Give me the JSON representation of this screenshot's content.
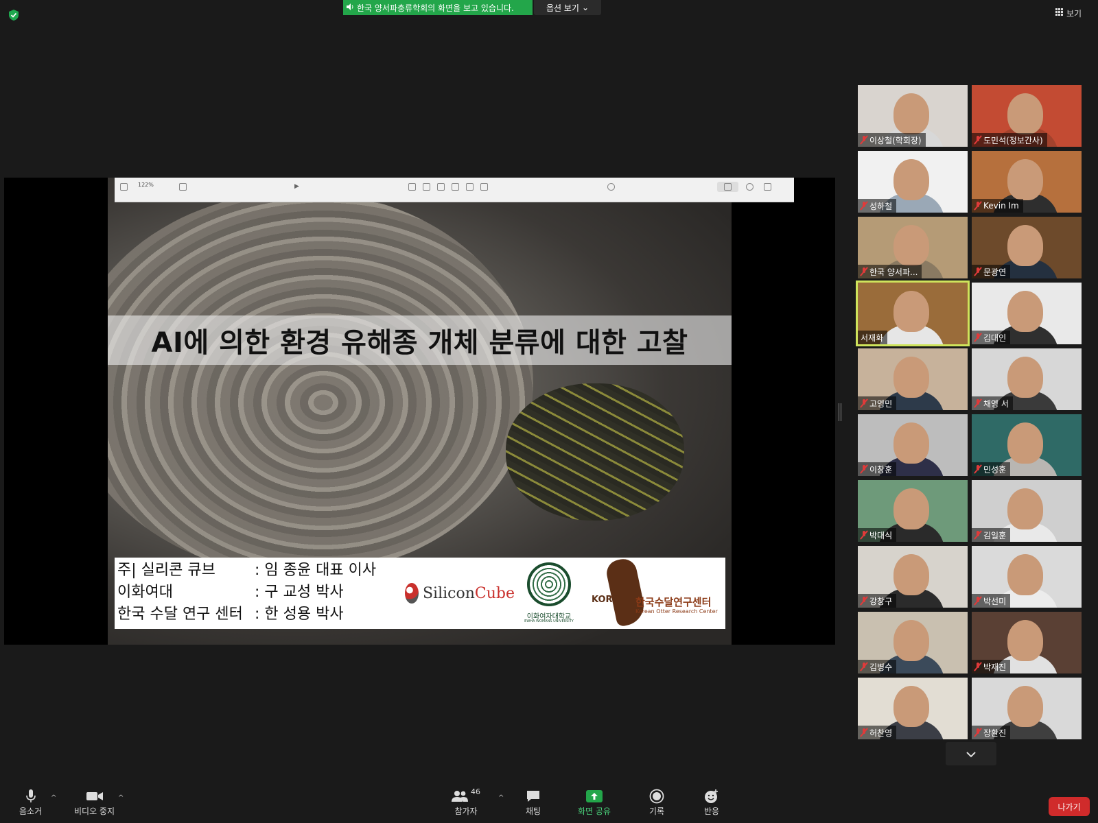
{
  "top_bar": {
    "share_banner_text": "한국 양서파충류학회의 화면을 보고 있습니다.",
    "options_label": "옵션 보기",
    "view_label": "보기"
  },
  "slide": {
    "toolbar_zoom": "122%",
    "title": "AI에 의한 환경 유해종 개체 분류에 대한 고찰",
    "credits": [
      {
        "org": "주| 실리콘 큐브",
        "person": ": 임 종윤 대표 이사"
      },
      {
        "org": "이화여대",
        "person": ": 구 교성 박사"
      },
      {
        "org": "한국 수달 연구 센터",
        "person": ": 한 성용 박사"
      }
    ],
    "logos": {
      "siliconcube_a": "Silicon",
      "siliconcube_b": "Cube",
      "ewha_name": "이화여자대학교",
      "ewha_sub": "EWHA WOMANS UNIVERSITY",
      "korc_abbr": "KORC",
      "korc_kr": "한국수달연구센터",
      "korc_en": "Korean Otter Research Center"
    }
  },
  "participants": [
    {
      "name": "이상철(학회장)",
      "muted": true,
      "bg": "#d9d4cf",
      "shirt": "#d8d8d8"
    },
    {
      "name": "도민석(정보간사)",
      "muted": true,
      "bg": "#c34b33",
      "shirt": "#a2422d"
    },
    {
      "name": "성하철",
      "muted": true,
      "bg": "#f1f1f1",
      "shirt": "#9aa8b6"
    },
    {
      "name": "Kevin Im",
      "muted": true,
      "bg": "#b6703d",
      "shirt": "#2e2e2e"
    },
    {
      "name": "한국 양서파...",
      "muted": true,
      "bg": "#b59b76",
      "shirt": "#8a7a62"
    },
    {
      "name": "문광연",
      "muted": true,
      "bg": "#6d4a2b",
      "shirt": "#24303f"
    },
    {
      "name": "서재화",
      "muted": false,
      "bg": "#9a6c3a",
      "shirt": "#e6e6e6",
      "active": true
    },
    {
      "name": "김대인",
      "muted": true,
      "bg": "#e9e9e9",
      "shirt": "#2f2f2f"
    },
    {
      "name": "고영민",
      "muted": true,
      "bg": "#c7b29b",
      "shirt": "#2d3a4a"
    },
    {
      "name": "채영 서",
      "muted": true,
      "bg": "#d7d7d7",
      "shirt": "#3a3a3a"
    },
    {
      "name": "이창훈",
      "muted": true,
      "bg": "#bdbdbd",
      "shirt": "#2e2f48"
    },
    {
      "name": "민성훈",
      "muted": true,
      "bg": "#2f6a66",
      "shirt": "#b9b6b2"
    },
    {
      "name": "박대식",
      "muted": true,
      "bg": "#6e9a7a",
      "shirt": "#2a2a2a"
    },
    {
      "name": "김일훈",
      "muted": true,
      "bg": "#cfcfcf",
      "shirt": "#e9e9e9"
    },
    {
      "name": "강창구",
      "muted": true,
      "bg": "#d7d3cc",
      "shirt": "#2b2b2b"
    },
    {
      "name": "박선미",
      "muted": true,
      "bg": "#dadada",
      "shirt": "#ececec"
    },
    {
      "name": "김병수",
      "muted": true,
      "bg": "#c9c0b0",
      "shirt": "#3b4a5a"
    },
    {
      "name": "박재진",
      "muted": true,
      "bg": "#5a4034",
      "shirt": "#e1e1e1"
    },
    {
      "name": "허찬영",
      "muted": true,
      "bg": "#e2ddd3",
      "shirt": "#3b3e46"
    },
    {
      "name": "장환진",
      "muted": true,
      "bg": "#d9d9d9",
      "shirt": "#3f3f3f"
    }
  ],
  "bottom_bar": {
    "mute_label": "음소거",
    "video_label": "비디오 중지",
    "participants_label": "참가자",
    "participants_count": "46",
    "chat_label": "채팅",
    "share_label": "화면 공유",
    "record_label": "기록",
    "reactions_label": "반응",
    "leave_label": "나가기"
  },
  "colors": {
    "share_green": "#23a64a",
    "leave_red": "#d02b2b",
    "active_speaker": "#cfe45c",
    "muted_red": "#e03a3a"
  }
}
